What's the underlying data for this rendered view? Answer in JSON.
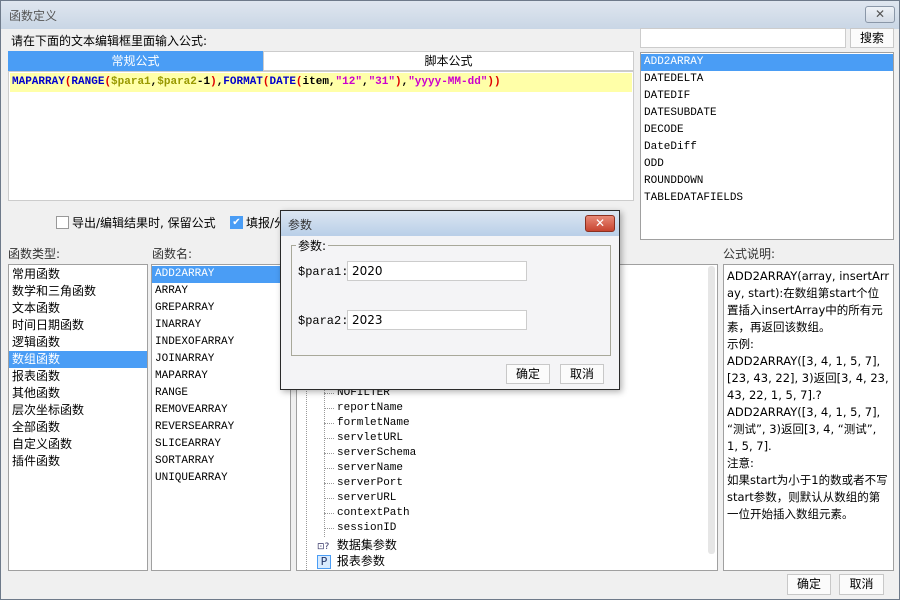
{
  "window": {
    "title": "函数定义"
  },
  "prompt": "请在下面的文本编辑框里面输入公式:",
  "tabs": [
    {
      "label": "常规公式",
      "active": true
    },
    {
      "label": "脚本公式",
      "active": false
    }
  ],
  "formula": {
    "parts": [
      {
        "t": "MAPARRAY",
        "c": "#0000cc"
      },
      {
        "t": "(",
        "c": "#e00000"
      },
      {
        "t": "RANGE",
        "c": "#0000cc"
      },
      {
        "t": "(",
        "c": "#e00000"
      },
      {
        "t": "$para1",
        "c": "#999900"
      },
      {
        "t": ",",
        "c": "#000"
      },
      {
        "t": "$para2",
        "c": "#999900"
      },
      {
        "t": "-1",
        "c": "#000"
      },
      {
        "t": ")",
        "c": "#e00000"
      },
      {
        "t": ",",
        "c": "#000"
      },
      {
        "t": "FORMAT",
        "c": "#0000cc"
      },
      {
        "t": "(",
        "c": "#e00000"
      },
      {
        "t": "DATE",
        "c": "#0000cc"
      },
      {
        "t": "(",
        "c": "#e00000"
      },
      {
        "t": "item,",
        "c": "#000"
      },
      {
        "t": "\"12\"",
        "c": "#cc00cc"
      },
      {
        "t": ",",
        "c": "#000"
      },
      {
        "t": "\"31\"",
        "c": "#cc00cc"
      },
      {
        "t": ")",
        "c": "#e00000"
      },
      {
        "t": ",",
        "c": "#000"
      },
      {
        "t": "\"yyyy-MM-dd\"",
        "c": "#cc00cc"
      },
      {
        "t": "))",
        "c": "#e00000"
      }
    ]
  },
  "search": {
    "value": "",
    "button": "搜索"
  },
  "search_results": [
    "ADD2ARRAY",
    "DATEDELTA",
    "DATEDIF",
    "DATESUBDATE",
    "DECODE",
    "DateDiff",
    "ODD",
    "ROUNDDOWN",
    "TABLEDATAFIELDS"
  ],
  "search_selected": 0,
  "options": [
    {
      "label": "导出/编辑结果时, 保留公式",
      "checked": false
    },
    {
      "label": "填报/分",
      "checked": true
    }
  ],
  "labels": {
    "types": "函数类型:",
    "names": "函数名:",
    "desc": "公式说明:"
  },
  "function_types": [
    "常用函数",
    "数学和三角函数",
    "文本函数",
    "时间日期函数",
    "逻辑函数",
    "数组函数",
    "报表函数",
    "其他函数",
    "层次坐标函数",
    "全部函数",
    "自定义函数",
    "插件函数"
  ],
  "function_types_selected": 5,
  "function_names": [
    "ADD2ARRAY",
    "ARRAY",
    "GREPARRAY",
    "INARRAY",
    "INDEXOFARRAY",
    "JOINARRAY",
    "MAPARRAY",
    "RANGE",
    "REMOVEARRAY",
    "REVERSEARRAY",
    "SLICEARRAY",
    "SORTARRAY",
    "UNIQUEARRAY"
  ],
  "function_names_selected": 0,
  "tree": {
    "items": [
      "NOFILTER",
      "reportName",
      "formletName",
      "servletURL",
      "serverSchema",
      "serverName",
      "serverPort",
      "serverURL",
      "contextPath",
      "sessionID"
    ],
    "groups": [
      {
        "label": "数据集参数",
        "icon": "dataset-param-icon"
      },
      {
        "label": "报表参数",
        "icon": "P"
      }
    ]
  },
  "description": "ADD2ARRAY(array, insertArray, start):在数组第start个位置插入insertArray中的所有元素，再返回该数组。\n示例:\nADD2ARRAY([3, 4, 1, 5, 7], [23, 43, 22], 3)返回[3, 4, 23, 43, 22, 1, 5, 7].?\nADD2ARRAY([3, 4, 1, 5, 7], “测试”, 3)返回[3, 4, “测试”, 1, 5, 7].\n注意:\n如果start为小于1的数或者不写start参数，则默认从数组的第一位开始插入数组元素。",
  "footer": {
    "ok": "确定",
    "cancel": "取消"
  },
  "dialog": {
    "title": "参数",
    "group": "参数:",
    "params": [
      {
        "label": "$para1:",
        "value": "2020"
      },
      {
        "label": "$para2:",
        "value": "2023"
      }
    ],
    "ok": "确定",
    "cancel": "取消"
  },
  "colors": {
    "accent": "#4a9df5",
    "highlight": "#ffffa8"
  }
}
